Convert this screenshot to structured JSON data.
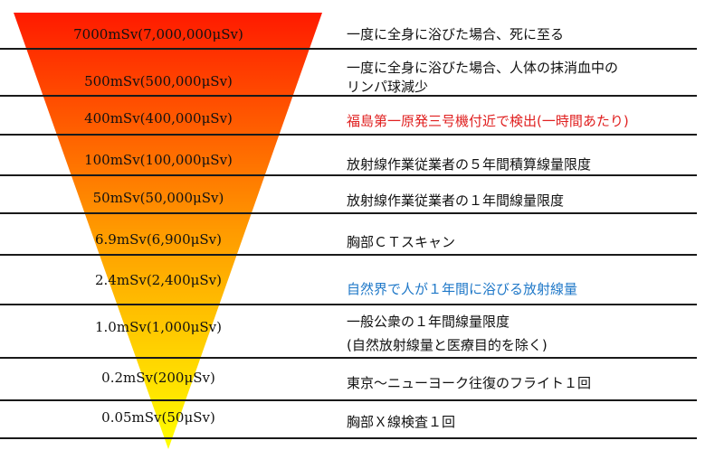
{
  "colors": {
    "gradient_top": "#ff1a00",
    "gradient_mid": "#ff9a00",
    "gradient_bottom": "#ffff00",
    "red_text": "#e02020",
    "blue_text": "#1f78c8"
  },
  "rows": [
    {
      "dose": "7000mSv(7,000,000μSv)",
      "desc_lines": [
        "一度に全身に浴びた場合、死に至る"
      ],
      "style": "normal"
    },
    {
      "dose": "500mSv(500,000μSv)",
      "desc_lines": [
        "一度に全身に浴びた場合、人体の抹消血中の",
        "リンパ球減少"
      ],
      "style": "normal"
    },
    {
      "dose": "400mSv(400,000μSv)",
      "desc_lines": [
        "福島第一原発三号機付近で検出(一時間あたり)"
      ],
      "style": "red"
    },
    {
      "dose": "100mSv(100,000μSv)",
      "desc_lines": [
        "放射線作業従業者の５年間積算線量限度"
      ],
      "style": "normal"
    },
    {
      "dose": "50mSv(50,000μSv)",
      "desc_lines": [
        "放射線作業従業者の１年間線量限度"
      ],
      "style": "normal"
    },
    {
      "dose": "6.9mSv(6,900μSv)",
      "desc_lines": [
        "胸部ＣＴスキャン"
      ],
      "style": "normal"
    },
    {
      "dose": "2.4mSv(2,400μSv)",
      "desc_lines": [
        "自然界で人が１年間に浴びる放射線量"
      ],
      "style": "blue"
    },
    {
      "dose": "1.0mSv(1,000μSv)",
      "desc_lines": [
        "一般公衆の１年間線量限度",
        "(自然放射線量と医療目的を除く)"
      ],
      "style": "normal"
    },
    {
      "dose": "0.2mSv(200μSv)",
      "desc_lines": [
        "東京〜ニューヨーク往復のフライト１回"
      ],
      "style": "normal"
    },
    {
      "dose": "0.05mSv(50μSv)",
      "desc_lines": [
        "胸部Ｘ線検査１回"
      ],
      "style": "normal"
    }
  ]
}
